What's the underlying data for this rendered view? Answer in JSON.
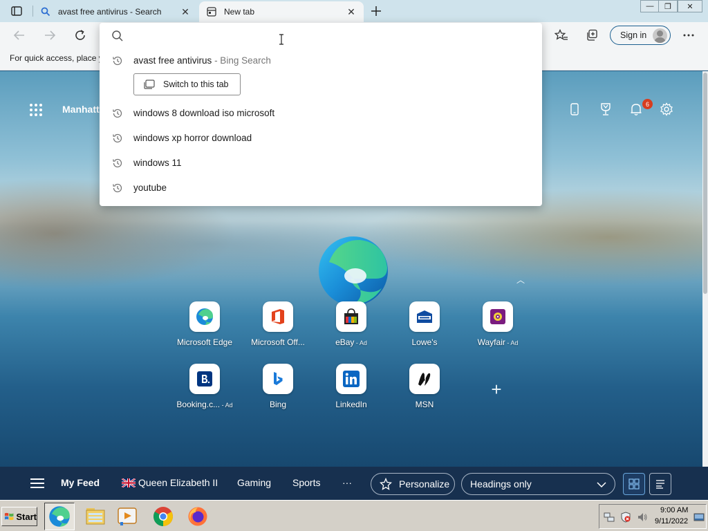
{
  "tabs": [
    {
      "title": "avast free antivirus - Search",
      "active": false
    },
    {
      "title": "New tab",
      "active": true
    }
  ],
  "window_controls": {
    "minimize": "—",
    "restore": "❐",
    "close": "✕"
  },
  "toolbar": {
    "signin_label": "Sign in"
  },
  "favorites_bar": {
    "hint": "For quick access, place y"
  },
  "omnibox": {
    "query": "",
    "placeholder": "",
    "suggestions": [
      {
        "text": "avast free antivirus",
        "sub": " - Bing Search",
        "action_label": "Switch to this tab"
      },
      {
        "text": "windows 8 download iso microsoft"
      },
      {
        "text": "windows xp horror download"
      },
      {
        "text": "windows 11"
      },
      {
        "text": "youtube"
      }
    ]
  },
  "newtab": {
    "location_text": "Manhatta",
    "notifications_count": "6",
    "tiles": [
      {
        "label": "Microsoft Edge",
        "ad": "",
        "icon": "edge-icon"
      },
      {
        "label": "Microsoft Off...",
        "ad": "",
        "icon": "office-icon"
      },
      {
        "label": "eBay",
        "ad": " - Ad",
        "icon": "ebay-icon"
      },
      {
        "label": "Lowe's",
        "ad": "",
        "icon": "lowes-icon"
      },
      {
        "label": "Wayfair",
        "ad": " - Ad",
        "icon": "wayfair-icon"
      },
      {
        "label": "Booking.c...",
        "ad": " - Ad",
        "icon": "booking-icon"
      },
      {
        "label": "Bing",
        "ad": "",
        "icon": "bing-icon"
      },
      {
        "label": "LinkedIn",
        "ad": "",
        "icon": "linkedin-icon"
      },
      {
        "label": "MSN",
        "ad": "",
        "icon": "msn-icon"
      }
    ]
  },
  "feed": {
    "items": [
      "My Feed",
      "Queen Elizabeth II",
      "Gaming",
      "Sports",
      "···"
    ],
    "personalize_label": "Personalize",
    "layout_select": "Headings only"
  },
  "taskbar": {
    "start_label": "Start",
    "clock_time": "9:00 AM",
    "clock_date": "9/11/2022"
  },
  "colors": {
    "accent": "#1b5f90",
    "feedbar": "#17304f",
    "badge": "#d73d1f"
  }
}
